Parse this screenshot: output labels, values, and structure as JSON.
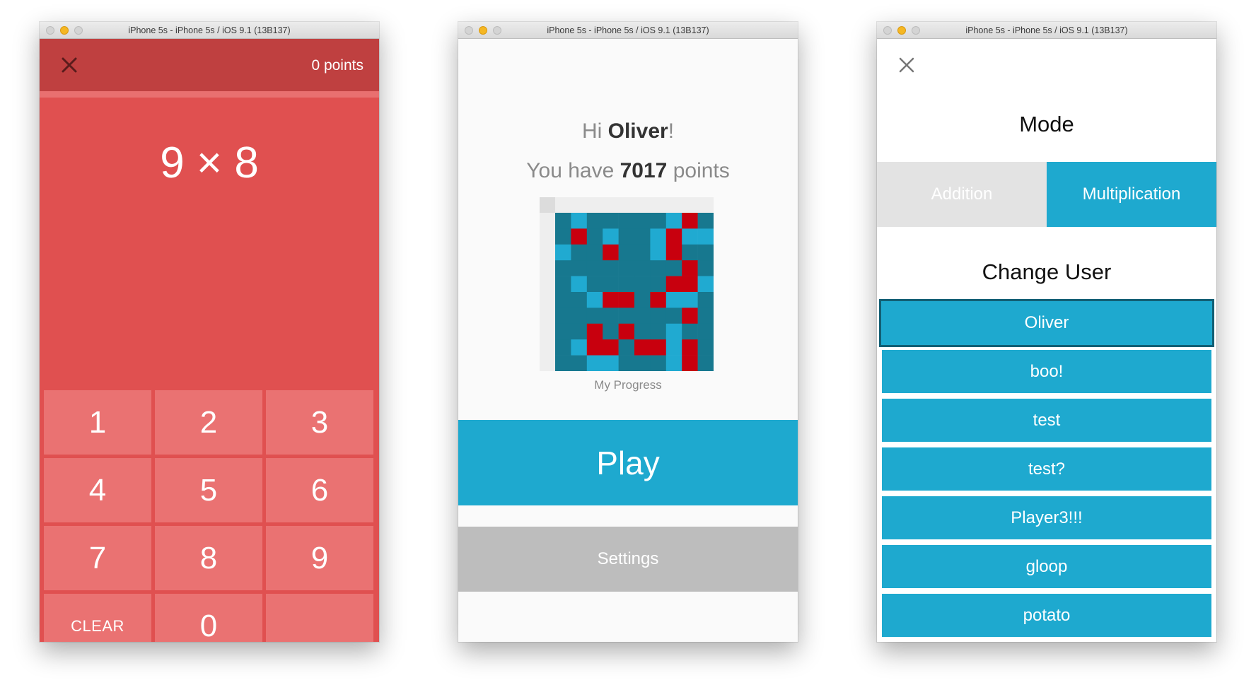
{
  "windows": [
    {
      "title": "iPhone 5s - iPhone 5s / iOS 9.1 (13B137)",
      "points_label": "0 points",
      "question": "9 × 8",
      "keys": [
        "1",
        "2",
        "3",
        "4",
        "5",
        "6",
        "7",
        "8",
        "9",
        "CLEAR",
        "0",
        ""
      ]
    },
    {
      "title": "iPhone 5s - iPhone 5s / iOS 9.1 (13B137)",
      "greeting_prefix": "Hi ",
      "user_name": "Oliver",
      "greeting_suffix": "!",
      "points_prefix": "You have ",
      "points_value": "7017",
      "points_suffix": " points",
      "progress_label": "My Progress",
      "play_label": "Play",
      "settings_label": "Settings",
      "progress_grid": [
        [
          0,
          1,
          0,
          0,
          0,
          0,
          0,
          1,
          2,
          0
        ],
        [
          0,
          2,
          0,
          1,
          0,
          0,
          1,
          2,
          1,
          1
        ],
        [
          1,
          0,
          0,
          2,
          0,
          0,
          1,
          2,
          0,
          0
        ],
        [
          0,
          0,
          0,
          0,
          0,
          0,
          0,
          0,
          2,
          0
        ],
        [
          0,
          1,
          0,
          0,
          0,
          0,
          0,
          2,
          2,
          1
        ],
        [
          0,
          0,
          1,
          2,
          2,
          0,
          2,
          1,
          1,
          0
        ],
        [
          0,
          0,
          0,
          0,
          0,
          0,
          0,
          0,
          2,
          0
        ],
        [
          0,
          0,
          2,
          0,
          2,
          0,
          0,
          1,
          0,
          0
        ],
        [
          0,
          1,
          2,
          2,
          0,
          2,
          2,
          1,
          2,
          0
        ],
        [
          0,
          0,
          1,
          1,
          0,
          0,
          0,
          1,
          2,
          0
        ]
      ],
      "progress_colors": [
        "#17788f",
        "#20aad1",
        "#c8000e"
      ]
    },
    {
      "title": "iPhone 5s - iPhone 5s / iOS 9.1 (13B137)",
      "mode_title": "Mode",
      "mode_addition": "Addition",
      "mode_multiplication": "Multiplication",
      "change_user_title": "Change User",
      "users": [
        "Oliver",
        "boo!",
        "test",
        "test?",
        "Player3!!!",
        "gloop",
        "potato",
        ""
      ]
    }
  ],
  "colors": {
    "red_background": "#e05050",
    "red_header": "#bf4040",
    "key_color": "#ea7272",
    "accent_blue": "#1ea9cf",
    "settings_gray": "#bdbdbd"
  }
}
